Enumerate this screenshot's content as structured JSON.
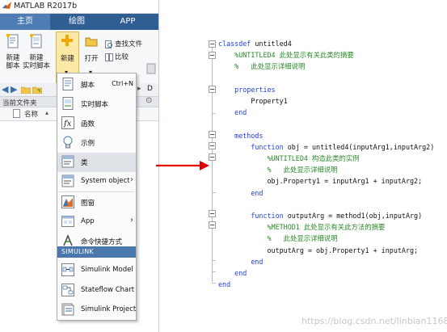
{
  "window": {
    "title": "MATLAB R2017b",
    "tabs": [
      {
        "label": "主页",
        "active": true
      },
      {
        "label": "绘图",
        "active": false
      },
      {
        "label": "APP",
        "active": false
      }
    ]
  },
  "ribbon": {
    "new_script": "新建\n脚本",
    "new_live_script": "新建\n实时脚本",
    "new": "新建",
    "open": "打开",
    "find_files": "查找文件",
    "compare": "比较"
  },
  "address_bar": {
    "path_fragment": "D"
  },
  "current_folder": {
    "title": "当前文件夹",
    "column_name": "名称"
  },
  "new_menu": {
    "items": [
      {
        "label": "脚本",
        "shortcut": "Ctrl+N",
        "icon": "script-icon"
      },
      {
        "label": "实时脚本",
        "icon": "live-script-icon"
      },
      {
        "label": "函数",
        "icon": "function-icon"
      },
      {
        "label": "示例",
        "icon": "example-bulb-icon"
      },
      {
        "label": "类",
        "icon": "class-icon",
        "highlighted": true
      },
      {
        "label": "System object",
        "icon": "system-object-icon",
        "submenu": true
      },
      {
        "label": "图窗",
        "icon": "figure-icon"
      },
      {
        "label": "App",
        "icon": "app-icon",
        "submenu": true
      },
      {
        "label": "命令快捷方式",
        "icon": "command-shortcut-icon"
      }
    ],
    "section_title": "SIMULINK",
    "simulink_items": [
      {
        "label": "Simulink Model",
        "icon": "simulink-model-icon"
      },
      {
        "label": "Stateflow Chart",
        "icon": "stateflow-chart-icon"
      },
      {
        "label": "Simulink Project",
        "icon": "simulink-project-icon"
      }
    ]
  },
  "code": {
    "lines": [
      [
        {
          "t": "classdef",
          "c": "kw"
        },
        {
          "t": " untitled4",
          "c": "tx"
        }
      ],
      [
        {
          "t": "    %UNTITLED4 此处显示有关此类的摘要",
          "c": "cm"
        }
      ],
      [
        {
          "t": "    %   此处显示详细说明",
          "c": "cm"
        }
      ],
      [],
      [
        {
          "t": "    ",
          "c": "tx"
        },
        {
          "t": "properties",
          "c": "kw"
        }
      ],
      [
        {
          "t": "        Property1",
          "c": "tx"
        }
      ],
      [
        {
          "t": "    ",
          "c": "tx"
        },
        {
          "t": "end",
          "c": "kw"
        }
      ],
      [],
      [
        {
          "t": "    ",
          "c": "tx"
        },
        {
          "t": "methods",
          "c": "kw"
        }
      ],
      [
        {
          "t": "        ",
          "c": "tx"
        },
        {
          "t": "function",
          "c": "kw"
        },
        {
          "t": " obj = untitled4(inputArg1,inputArg2)",
          "c": "tx"
        }
      ],
      [
        {
          "t": "            %UNTITLED4 构造此类的实例",
          "c": "cm"
        }
      ],
      [
        {
          "t": "            %   此处显示详细说明",
          "c": "cm"
        }
      ],
      [
        {
          "t": "            obj.Property1 = inputArg1 + inputArg2;",
          "c": "tx"
        }
      ],
      [
        {
          "t": "        ",
          "c": "tx"
        },
        {
          "t": "end",
          "c": "kw"
        }
      ],
      [],
      [
        {
          "t": "        ",
          "c": "tx"
        },
        {
          "t": "function",
          "c": "kw"
        },
        {
          "t": " outputArg = method1(obj,inputArg)",
          "c": "tx"
        }
      ],
      [
        {
          "t": "            %METHOD1 此处显示有关此方法的摘要",
          "c": "cm"
        }
      ],
      [
        {
          "t": "            %   此处显示详细说明",
          "c": "cm"
        }
      ],
      [
        {
          "t": "            outputArg = obj.Property1 + inputArg;",
          "c": "tx"
        }
      ],
      [
        {
          "t": "        ",
          "c": "tx"
        },
        {
          "t": "end",
          "c": "kw"
        }
      ],
      [
        {
          "t": "    ",
          "c": "tx"
        },
        {
          "t": "end",
          "c": "kw"
        }
      ],
      [
        {
          "t": "end",
          "c": "kw"
        }
      ]
    ]
  },
  "watermark": "https://blog.csdn.net/linbian1168",
  "colors": {
    "tab_bar": "#2f5e93",
    "menu_section": "#4a78ad",
    "keyword": "#1f3ff0",
    "comment": "#2a8a2a",
    "arrow": "#e00000"
  }
}
